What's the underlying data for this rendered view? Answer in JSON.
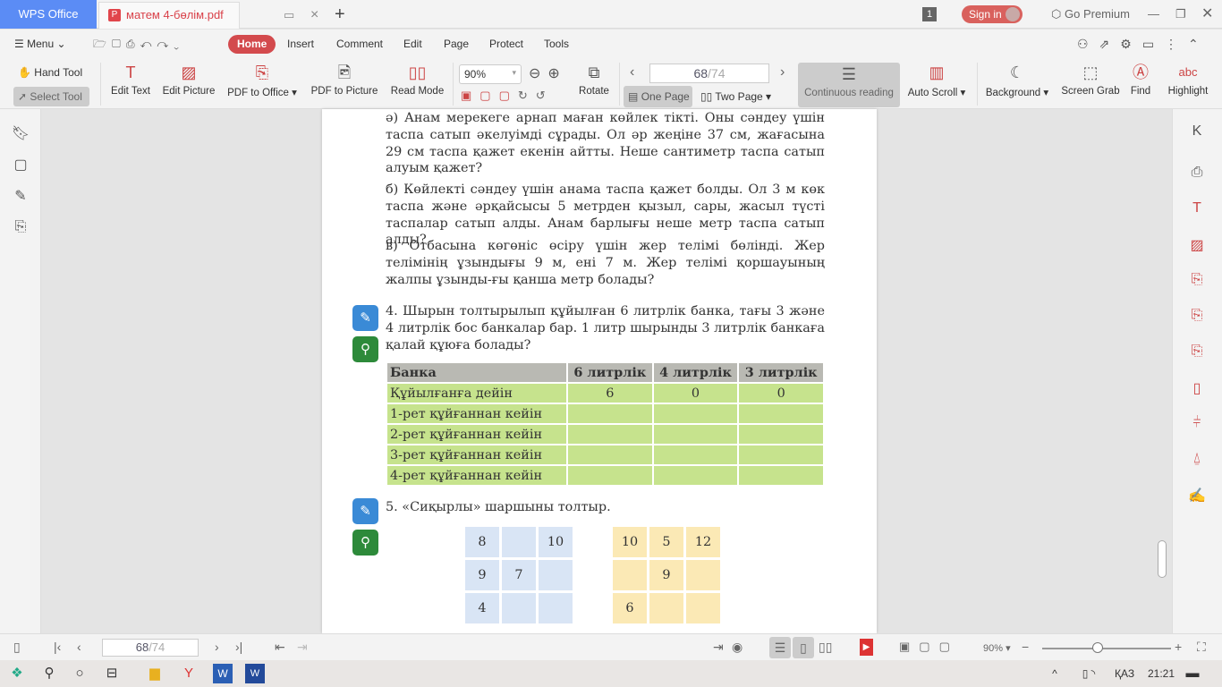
{
  "titlebar": {
    "app_tab": "WPS Office",
    "doc_tab": "матем 4-бөлім.pdf",
    "notif_count": "1",
    "sign_in": "Sign in",
    "premium": "Go Premium"
  },
  "menu": {
    "menu_label": "Menu",
    "tabs": [
      "Home",
      "Insert",
      "Comment",
      "Edit",
      "Page",
      "Protect",
      "Tools"
    ]
  },
  "toolbar": {
    "hand_tool": "Hand Tool",
    "select_tool": "Select Tool",
    "edit_text": "Edit Text",
    "edit_picture": "Edit Picture",
    "pdf_to_office": "PDF to Office",
    "pdf_to_picture": "PDF to Picture",
    "read_mode": "Read Mode",
    "zoom": "90%",
    "rotate": "Rotate",
    "page_current": "68",
    "page_total": "/74",
    "one_page": "One Page",
    "two_page": "Two Page",
    "continuous": "Continuous reading",
    "auto_scroll": "Auto Scroll",
    "background": "Background",
    "screen_grab": "Screen Grab",
    "find": "Find",
    "highlight": "Highlight"
  },
  "document": {
    "para_a": "ә) Анам мерекеге арнап маған көйлек тікті. Оны сәндеу үшін таспа сатып әкелуімді сұрады. Ол әр жеңіне 37 см, жағасына 29 см таспа қажет екенін айтты. Неше сантиметр таспа сатып алуым қажет?",
    "para_b": "б) Көйлекті сәндеу үшін анама таспа қажет болды. Ол 3 м көк таспа және әрқайсысы 5 метрден қызыл, сары, жасыл түсті таспалар сатып алды. Анам барлығы неше метр таспа сатып алды?",
    "para_v": "в) Отбасына көгөніс өсіру үшін жер телімі бөлінді. Жер телімінің ұзындығы 9 м, ені 7 м. Жер телімі қоршауының жалпы ұзынды-ғы қанша метр болады?",
    "task4": "4. Шырын толтырылып құйылған 6 литрлік банка, тағы 3 және 4 литрлік бос банкалар бар. 1 литр шырынды 3 литрлік банкаға қалай құюға болады?",
    "table": {
      "headers": [
        "Банка",
        "6 литрлік",
        "4 литрлік",
        "3 литрлік"
      ],
      "rows": [
        [
          "Құйылғанға дейін",
          "6",
          "0",
          "0"
        ],
        [
          "1-рет құйғаннан кейін",
          "",
          "",
          ""
        ],
        [
          "2-рет құйғаннан кейін",
          "",
          "",
          ""
        ],
        [
          "3-рет құйғаннан кейін",
          "",
          "",
          ""
        ],
        [
          "4-рет құйғаннан кейін",
          "",
          "",
          ""
        ]
      ]
    },
    "task5": "5. «Сиқырлы» шаршыны толтыр.",
    "square1": [
      "8",
      "",
      "10",
      "9",
      "7",
      "",
      "4",
      "",
      ""
    ],
    "square2": [
      "10",
      "5",
      "12",
      "",
      "9",
      "",
      "6",
      "",
      ""
    ]
  },
  "statusbar": {
    "page_current": "68",
    "page_total": "/74",
    "zoom": "90%"
  },
  "taskbar": {
    "lang": "ҚАЗ",
    "time": "21:21"
  }
}
